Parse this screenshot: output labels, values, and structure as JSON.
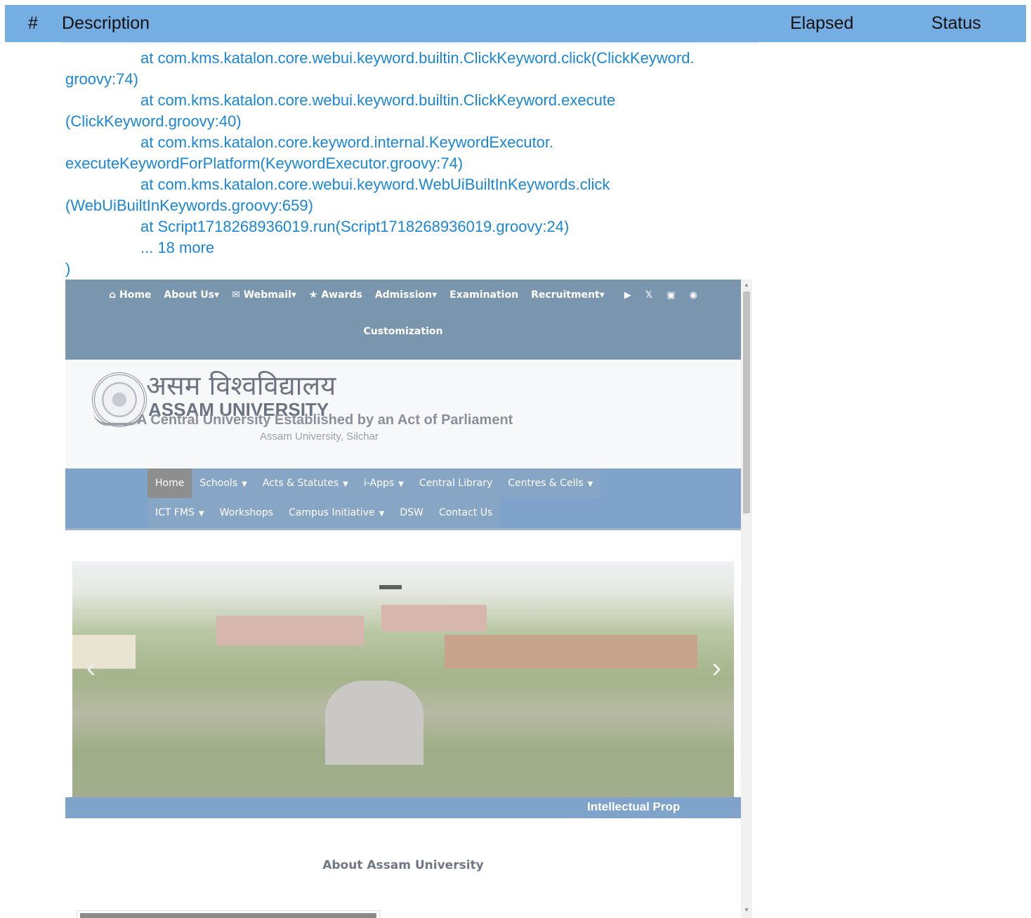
{
  "report": {
    "columns": {
      "num": "#",
      "description": "Description",
      "elapsed": "Elapsed",
      "status": "Status"
    }
  },
  "trace": [
    {
      "text": "at com.kms.katalon.core.webui.keyword.builtin.ClickKeyword.click(ClickKeyword.",
      "indent": true
    },
    {
      "text": "groovy:74)",
      "indent": false
    },
    {
      "text": "at com.kms.katalon.core.webui.keyword.builtin.ClickKeyword.execute",
      "indent": true
    },
    {
      "text": "(ClickKeyword.groovy:40)",
      "indent": false
    },
    {
      "text": "at com.kms.katalon.core.keyword.internal.KeywordExecutor.",
      "indent": true
    },
    {
      "text": "executeKeywordForPlatform(KeywordExecutor.groovy:74)",
      "indent": false
    },
    {
      "text": "at com.kms.katalon.core.webui.keyword.WebUiBuiltInKeywords.click",
      "indent": true
    },
    {
      "text": "(WebUiBuiltInKeywords.groovy:659)",
      "indent": false
    },
    {
      "text": "at Script1718268936019.run(Script1718268936019.groovy:24)",
      "indent": true
    },
    {
      "text": "... 18 more",
      "indent": true
    },
    {
      "text": ")",
      "indent": false
    }
  ],
  "site": {
    "topnav": {
      "home": "⌂ Home",
      "about": "About Us▾",
      "webmail": "✉ Webmail▾",
      "awards": "★ Awards",
      "admission": "Admission▾",
      "examination": "Examination",
      "recruitment": "Recruitment▾",
      "customization": "Customization"
    },
    "banner": {
      "hindi": "असम विश्वविद्यालय",
      "name": "ASSAM UNIVERSITY",
      "tagline": "A Central University Established by an Act of Parliament",
      "subtag": "Assam University, Silchar"
    },
    "menu": {
      "row1": [
        "Home",
        "Schools",
        "Acts & Statutes",
        "i-Apps",
        "Central Library",
        "Centres & Cells"
      ],
      "row2": [
        "ICT FMS",
        "Workshops",
        "Campus Initiative",
        "DSW",
        "Contact Us"
      ]
    },
    "ticker": "Intellectual Prop",
    "about_heading": "About Assam University"
  }
}
